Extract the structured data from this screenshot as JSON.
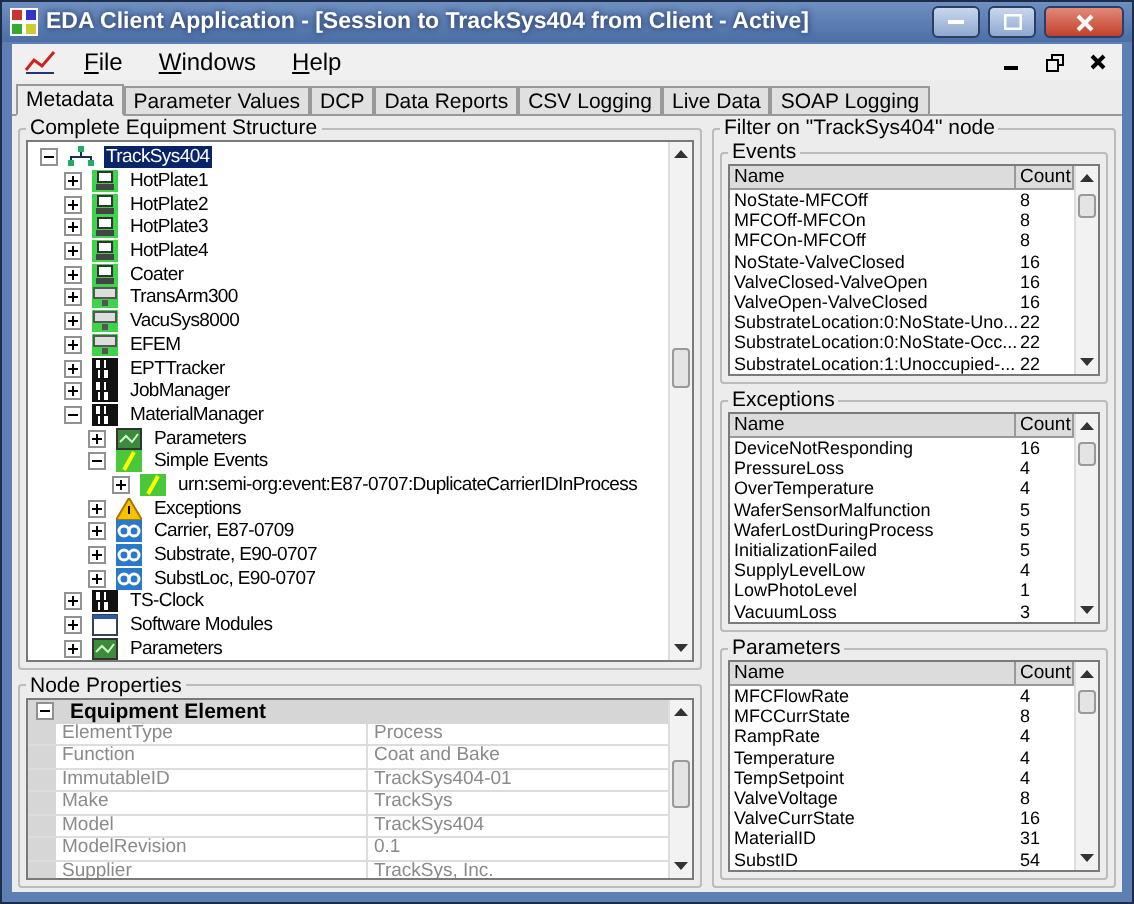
{
  "window": {
    "title": "EDA Client Application - [Session to TrackSys404 from Client - Active]"
  },
  "menu": [
    {
      "label": "File"
    },
    {
      "label": "Windows"
    },
    {
      "label": "Help"
    }
  ],
  "tabs": [
    {
      "label": "Metadata",
      "selected": true
    },
    {
      "label": "Parameter Values",
      "selected": false
    },
    {
      "label": "DCP",
      "selected": false
    },
    {
      "label": "Data Reports",
      "selected": false
    },
    {
      "label": "CSV Logging",
      "selected": false
    },
    {
      "label": "Live Data",
      "selected": false
    },
    {
      "label": "SOAP Logging",
      "selected": false
    }
  ],
  "structure": {
    "title": "Complete Equipment Structure",
    "tree": [
      {
        "label": "TrackSys404",
        "kind": "root",
        "expanded": true,
        "selected": true,
        "children": [
          {
            "label": "HotPlate1",
            "kind": "tool",
            "expanded": false,
            "selected": false
          },
          {
            "label": "HotPlate2",
            "kind": "tool",
            "expanded": false,
            "selected": false
          },
          {
            "label": "HotPlate3",
            "kind": "tool",
            "expanded": false,
            "selected": false
          },
          {
            "label": "HotPlate4",
            "kind": "tool",
            "expanded": false,
            "selected": false
          },
          {
            "label": "Coater",
            "kind": "tool",
            "expanded": false,
            "selected": false
          },
          {
            "label": "TransArm300",
            "kind": "module",
            "expanded": false,
            "selected": false
          },
          {
            "label": "VacuSys8000",
            "kind": "module",
            "expanded": false,
            "selected": false
          },
          {
            "label": "EFEM",
            "kind": "module",
            "expanded": false,
            "selected": false
          },
          {
            "label": "EPTTracker",
            "kind": "binary",
            "expanded": false,
            "selected": false
          },
          {
            "label": "JobManager",
            "kind": "binary",
            "expanded": false,
            "selected": false
          },
          {
            "label": "MaterialManager",
            "kind": "binary",
            "expanded": true,
            "selected": false,
            "children": [
              {
                "label": "Parameters",
                "kind": "parameters",
                "expanded": false,
                "selected": false
              },
              {
                "label": "Simple Events",
                "kind": "event",
                "expanded": true,
                "selected": false,
                "children": [
                  {
                    "label": "urn:semi-org:event:E87-0707:DuplicateCarrierIDInProcess",
                    "kind": "event",
                    "expanded": false,
                    "selected": false
                  }
                ]
              },
              {
                "label": "Exceptions",
                "kind": "exception",
                "expanded": false,
                "selected": false
              },
              {
                "label": "Carrier, E87-0709",
                "kind": "object",
                "expanded": false,
                "selected": false
              },
              {
                "label": "Substrate, E90-0707",
                "kind": "object",
                "expanded": false,
                "selected": false
              },
              {
                "label": "SubstLoc, E90-0707",
                "kind": "object",
                "expanded": false,
                "selected": false
              }
            ]
          },
          {
            "label": "TS-Clock",
            "kind": "binary",
            "expanded": false,
            "selected": false
          },
          {
            "label": "Software Modules",
            "kind": "window",
            "expanded": false,
            "selected": false
          },
          {
            "label": "Parameters",
            "kind": "parameters",
            "expanded": false,
            "selected": false
          }
        ]
      }
    ]
  },
  "properties": {
    "title": "Node Properties",
    "category": {
      "label": "Equipment Element",
      "expanded": true
    },
    "rows": [
      {
        "name": "ElementType",
        "value": "Process"
      },
      {
        "name": "Function",
        "value": "Coat and Bake"
      },
      {
        "name": "ImmutableID",
        "value": "TrackSys404-01"
      },
      {
        "name": "Make",
        "value": "TrackSys"
      },
      {
        "name": "Model",
        "value": "TrackSys404"
      },
      {
        "name": "ModelRevision",
        "value": "0.1"
      },
      {
        "name": "Supplier",
        "value": "TrackSys, Inc."
      }
    ]
  },
  "filter": {
    "title": "Filter on \"TrackSys404\" node",
    "groups": [
      {
        "title": "Events",
        "columns": [
          "Name",
          "Count"
        ],
        "rows": [
          [
            "NoState-MFCOff",
            "8"
          ],
          [
            "MFCOff-MFCOn",
            "8"
          ],
          [
            "MFCOn-MFCOff",
            "8"
          ],
          [
            "NoState-ValveClosed",
            "16"
          ],
          [
            "ValveClosed-ValveOpen",
            "16"
          ],
          [
            "ValveOpen-ValveClosed",
            "16"
          ],
          [
            "SubstrateLocation:0:NoState-Uno...",
            "22"
          ],
          [
            "SubstrateLocation:0:NoState-Occ...",
            "22"
          ],
          [
            "SubstrateLocation:1:Unoccupied-...",
            "22"
          ]
        ]
      },
      {
        "title": "Exceptions",
        "columns": [
          "Name",
          "Count"
        ],
        "rows": [
          [
            "DeviceNotResponding",
            "16"
          ],
          [
            "PressureLoss",
            "4"
          ],
          [
            "OverTemperature",
            "4"
          ],
          [
            "WaferSensorMalfunction",
            "5"
          ],
          [
            "WaferLostDuringProcess",
            "5"
          ],
          [
            "InitializationFailed",
            "5"
          ],
          [
            "SupplyLevelLow",
            "4"
          ],
          [
            "LowPhotoLevel",
            "1"
          ],
          [
            "VacuumLoss",
            "3"
          ]
        ]
      },
      {
        "title": "Parameters",
        "columns": [
          "Name",
          "Count"
        ],
        "rows": [
          [
            "MFCFlowRate",
            "4"
          ],
          [
            "MFCCurrState",
            "8"
          ],
          [
            "RampRate",
            "4"
          ],
          [
            "Temperature",
            "4"
          ],
          [
            "TempSetpoint",
            "4"
          ],
          [
            "ValveVoltage",
            "8"
          ],
          [
            "ValveCurrState",
            "16"
          ],
          [
            "MaterialID",
            "31"
          ],
          [
            "SubstID",
            "54"
          ]
        ]
      }
    ]
  }
}
